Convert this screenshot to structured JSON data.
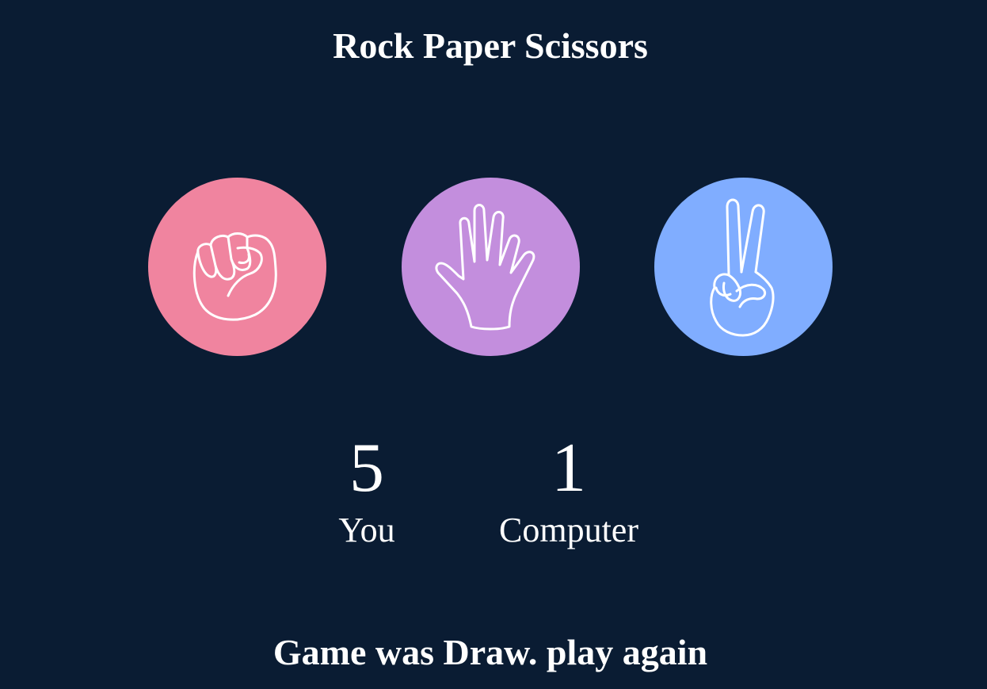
{
  "title": "Rock Paper Scissors",
  "choices": [
    {
      "id": "rock",
      "icon": "fist-icon",
      "color": "#f0849f"
    },
    {
      "id": "paper",
      "icon": "open-hand-icon",
      "color": "#c38edd"
    },
    {
      "id": "scissors",
      "icon": "peace-hand-icon",
      "color": "#80adff"
    }
  ],
  "scores": {
    "you": {
      "value": "5",
      "label": "You"
    },
    "computer": {
      "value": "1",
      "label": "Computer"
    }
  },
  "result_message": "Game was Draw. play again",
  "colors": {
    "background": "#0a1c33",
    "text": "#ffffff"
  }
}
